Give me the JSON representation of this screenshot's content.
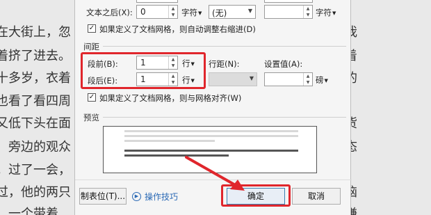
{
  "background_text": {
    "left_lines": [
      "在大街上，忽",
      "着挤了进去。",
      "十多岁，衣着",
      "也看了看四周",
      "又低下头在面",
      "旁边的观众",
      "。过了一会，",
      "过，他的两只",
      "。一个带着"
    ],
    "right_lines": [
      "我",
      "着",
      "的",
      "货",
      "态",
      "，",
      "恼",
      "嫌"
    ]
  },
  "dialog": {
    "text_after": {
      "label": "文本之后(X):",
      "value": "0",
      "unit": "字符",
      "special_value": "(无)",
      "unit2": "字符"
    },
    "snap_right_indent_label": "如果定义了文档网格，则自动调整右缩进(D)",
    "spacing_section": "间距",
    "before": {
      "label": "段前(B):",
      "value": "1",
      "unit": "行"
    },
    "after": {
      "label": "段后(E):",
      "value": "1",
      "unit": "行"
    },
    "line_spacing_label": "行距(N):",
    "setting_value_label": "设置值(A):",
    "setting_value_unit": "磅",
    "snap_grid_label": "如果定义了文档网格，则与网格对齐(W)",
    "preview_section": "预览",
    "preview_text": {
      "prev_para": "前一段落前一段落前一段落前一段落前一段落前一段落前一段落前一段落前一段落前一段落",
      "sample": "李强在眼里的早上到往了，每天都在做的事情，他的家里很近，没有想过是要进入的地方。"
    },
    "buttons": {
      "tabs": "制表位(T)...",
      "tips": "操作技巧",
      "ok": "确定",
      "cancel": "取消"
    }
  },
  "colors": {
    "highlight": "#e0262c",
    "link": "#2a69b5"
  }
}
